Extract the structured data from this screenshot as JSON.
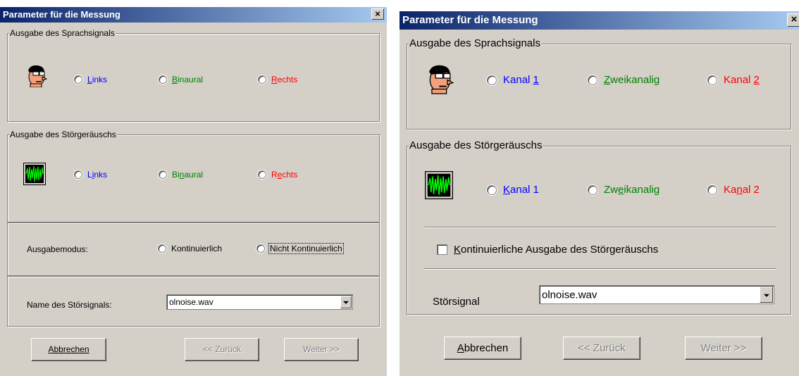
{
  "left": {
    "title": "Parameter für die Messung",
    "close": "×",
    "speech_group": "Ausgabe des Sprachsignals",
    "speech_options": [
      {
        "pre": "",
        "acc": "L",
        "post": "inks"
      },
      {
        "pre": "",
        "acc": "B",
        "post": "inaural"
      },
      {
        "pre": "",
        "acc": "R",
        "post": "echts"
      }
    ],
    "noise_group": "Ausgabe des Störgeräuschs",
    "noise_options": [
      {
        "pre": "L",
        "acc": "i",
        "post": "nks"
      },
      {
        "pre": "Bi",
        "acc": "n",
        "post": "aural"
      },
      {
        "pre": "R",
        "acc": "e",
        "post": "chts"
      }
    ],
    "mode_label": "Ausgabemodus:",
    "mode_options": [
      "Kontinuierlich",
      "Nicht Kontinuierlich"
    ],
    "mode_selected": 1,
    "noise_name_label": "Name des Störsignals:",
    "noise_file": "olnoise.wav",
    "buttons": {
      "cancel": "Abbrechen",
      "back": "<< Zurück",
      "next": "Weiter >>"
    }
  },
  "right": {
    "title": "Parameter für die Messung",
    "close": "×",
    "speech_group": "Ausgabe des Sprachsignals",
    "speech_options": [
      {
        "pre": "Kanal ",
        "acc": "1",
        "post": ""
      },
      {
        "pre": "",
        "acc": "Z",
        "post": "weikanalig"
      },
      {
        "pre": "Kanal ",
        "acc": "2",
        "post": ""
      }
    ],
    "noise_group": "Ausgabe des Störgeräuschs",
    "noise_options": [
      {
        "pre": "",
        "acc": "K",
        "post": "anal 1"
      },
      {
        "pre": "Zw",
        "acc": "e",
        "post": "ikanalig"
      },
      {
        "pre": "Ka",
        "acc": "n",
        "post": "al 2"
      }
    ],
    "continuous_checkbox": {
      "pre": "",
      "acc": "K",
      "post": "ontinuierliche Ausgabe des Störgeräuschs",
      "checked": false
    },
    "noise_signal_label": "Störsignal",
    "noise_file": "olnoise.wav",
    "buttons": {
      "cancel": "Abbrechen",
      "back": "<< Zurück",
      "next": "Weiter >>"
    }
  },
  "icons": {
    "speech": "face-icon",
    "noise": "waveform-icon"
  }
}
